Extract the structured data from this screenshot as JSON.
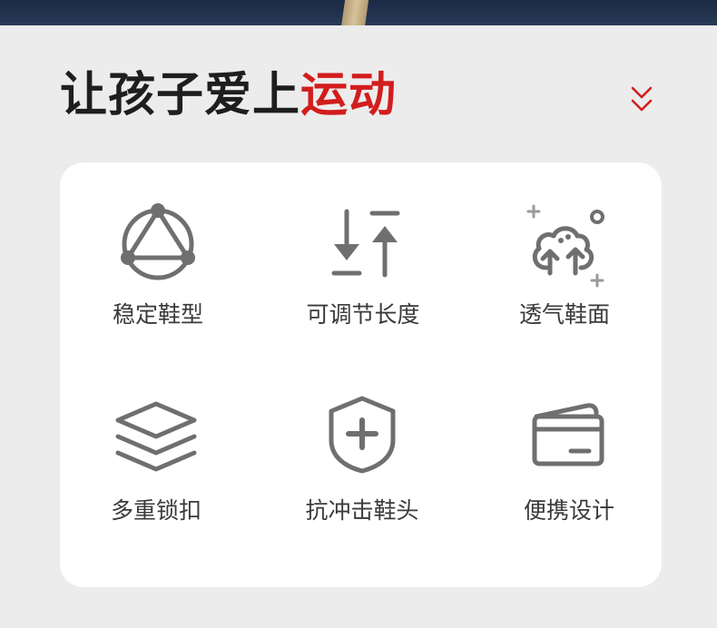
{
  "headline": {
    "part1": "让孩子爱上",
    "part2": "运动"
  },
  "more_icon": "double-chevron-down-icon",
  "colors": {
    "accent": "#d21d1d",
    "text": "#1e1e1e",
    "icon": "#6f6f6f",
    "label": "#3a3a3a",
    "card": "#ffffff",
    "background": "#ececec"
  },
  "features": [
    {
      "label": "稳定鞋型",
      "icon": "triangle-stability-icon"
    },
    {
      "label": "可调节长度",
      "icon": "adjust-length-icon"
    },
    {
      "label": "透气鞋面",
      "icon": "breathable-tree-icon"
    },
    {
      "label": "多重锁扣",
      "icon": "layers-icon"
    },
    {
      "label": "抗冲击鞋头",
      "icon": "shield-plus-icon"
    },
    {
      "label": "便携设计",
      "icon": "wallet-icon"
    }
  ]
}
